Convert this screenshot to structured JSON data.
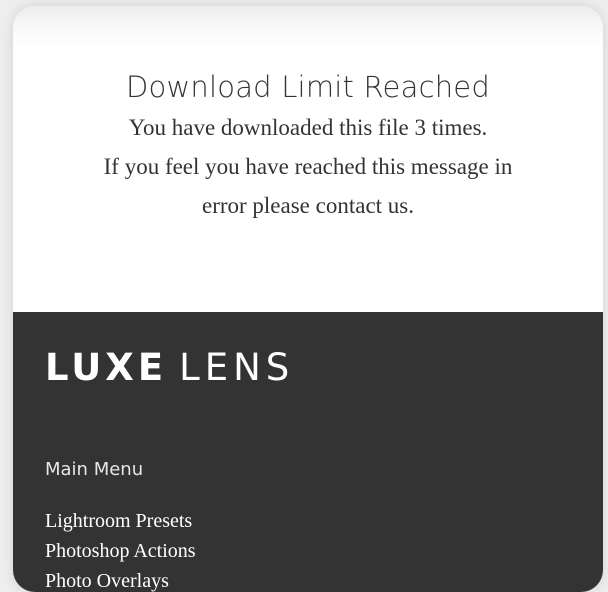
{
  "message": {
    "title": "Download Limit Reached",
    "line1": "You have downloaded this file 3 times.",
    "line2": "If you feel you have reached this message in",
    "line3": "error please contact us."
  },
  "footer": {
    "logo_bold": "LUXE",
    "logo_light": "LENS",
    "menu_heading": "Main Menu",
    "menu_items": [
      {
        "label": "Lightroom Presets"
      },
      {
        "label": "Photoshop Actions"
      },
      {
        "label": "Photo Overlays"
      }
    ]
  },
  "colors": {
    "footer_background": "#333333",
    "text_dark": "#333333",
    "text_light": "#ffffff"
  }
}
